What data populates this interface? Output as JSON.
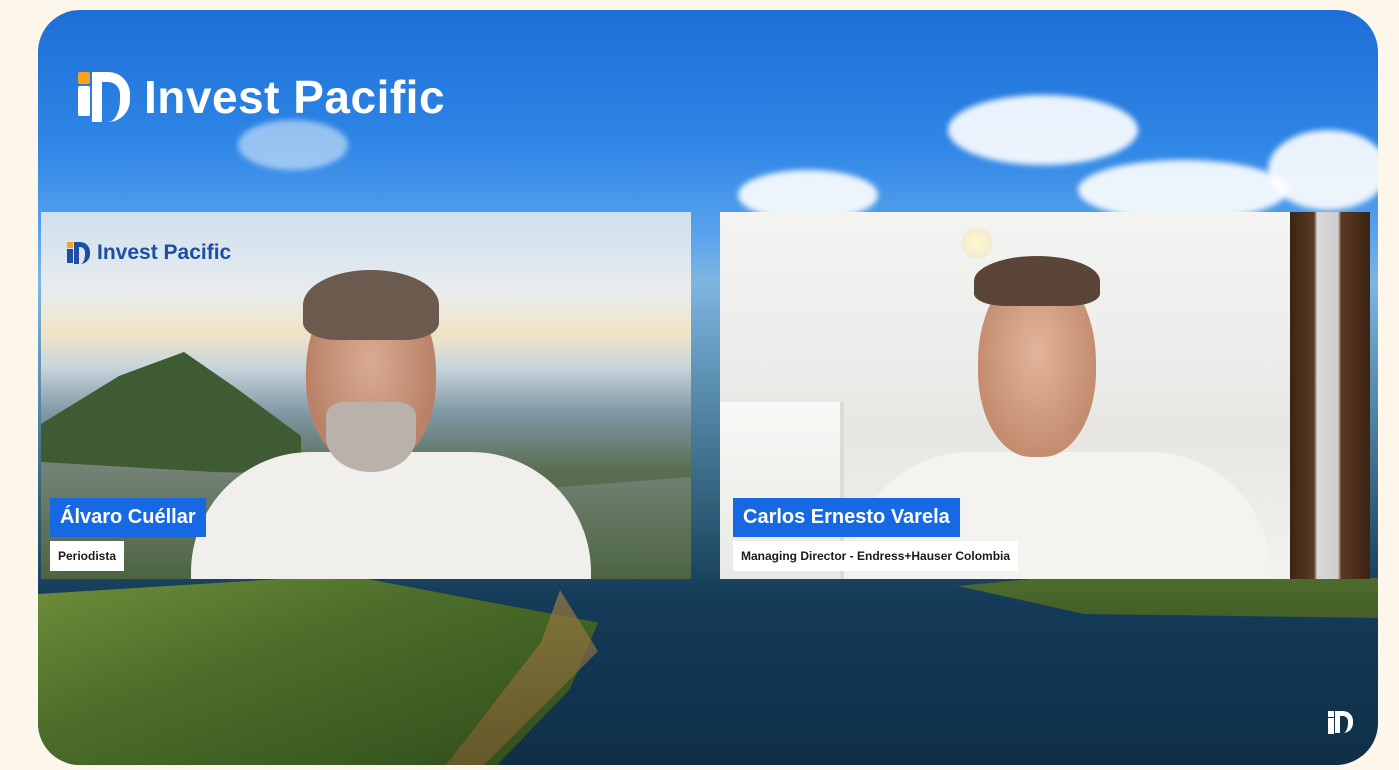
{
  "header": {
    "brand": "Invest Pacific"
  },
  "left_panel": {
    "brand": "Invest Pacific",
    "name": "Álvaro Cuéllar",
    "role": "Periodista"
  },
  "right_panel": {
    "name": "Carlos Ernesto Varela",
    "role": "Managing Director - Endress+Hauser Colombia"
  },
  "colors": {
    "brand_blue": "#1769e3",
    "brand_orange": "#f7a31c",
    "page_background": "#fdf6ea"
  }
}
